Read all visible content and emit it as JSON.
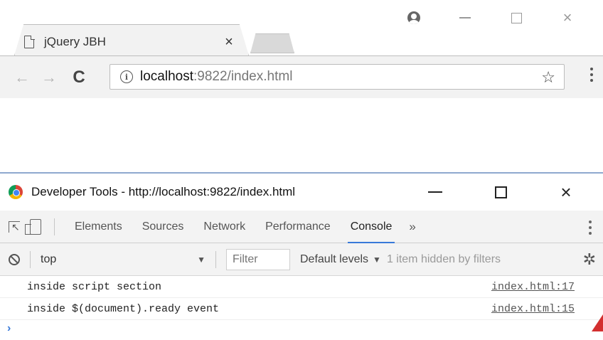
{
  "browser": {
    "tab_title": "jQuery JBH",
    "tab_close": "×",
    "url_host": "localhost",
    "url_rest": ":9822/index.html",
    "back": "←",
    "forward": "→",
    "reload": "C",
    "info": "i",
    "star": "☆",
    "win_close": "×"
  },
  "devtools": {
    "window_title": "Developer Tools - http://localhost:9822/index.html",
    "close": "×",
    "tabs": [
      "Elements",
      "Sources",
      "Network",
      "Performance",
      "Console"
    ],
    "active_tab": "Console",
    "more_tabs": "»",
    "context": "top",
    "filter_placeholder": "Filter",
    "levels": "Default levels",
    "levels_caret": "▼",
    "context_caret": "▼",
    "hidden_note": "1 item hidden by filters",
    "gear": "✲",
    "prompt": "›"
  },
  "console": {
    "rows": [
      {
        "message": "inside script section",
        "source": "index.html:17"
      },
      {
        "message": "inside $(document).ready event",
        "source": "index.html:15"
      }
    ]
  },
  "colors": {
    "accent": "#3879d9",
    "devtools_border": "#8ea9cf",
    "marker": "#d32f2f"
  }
}
